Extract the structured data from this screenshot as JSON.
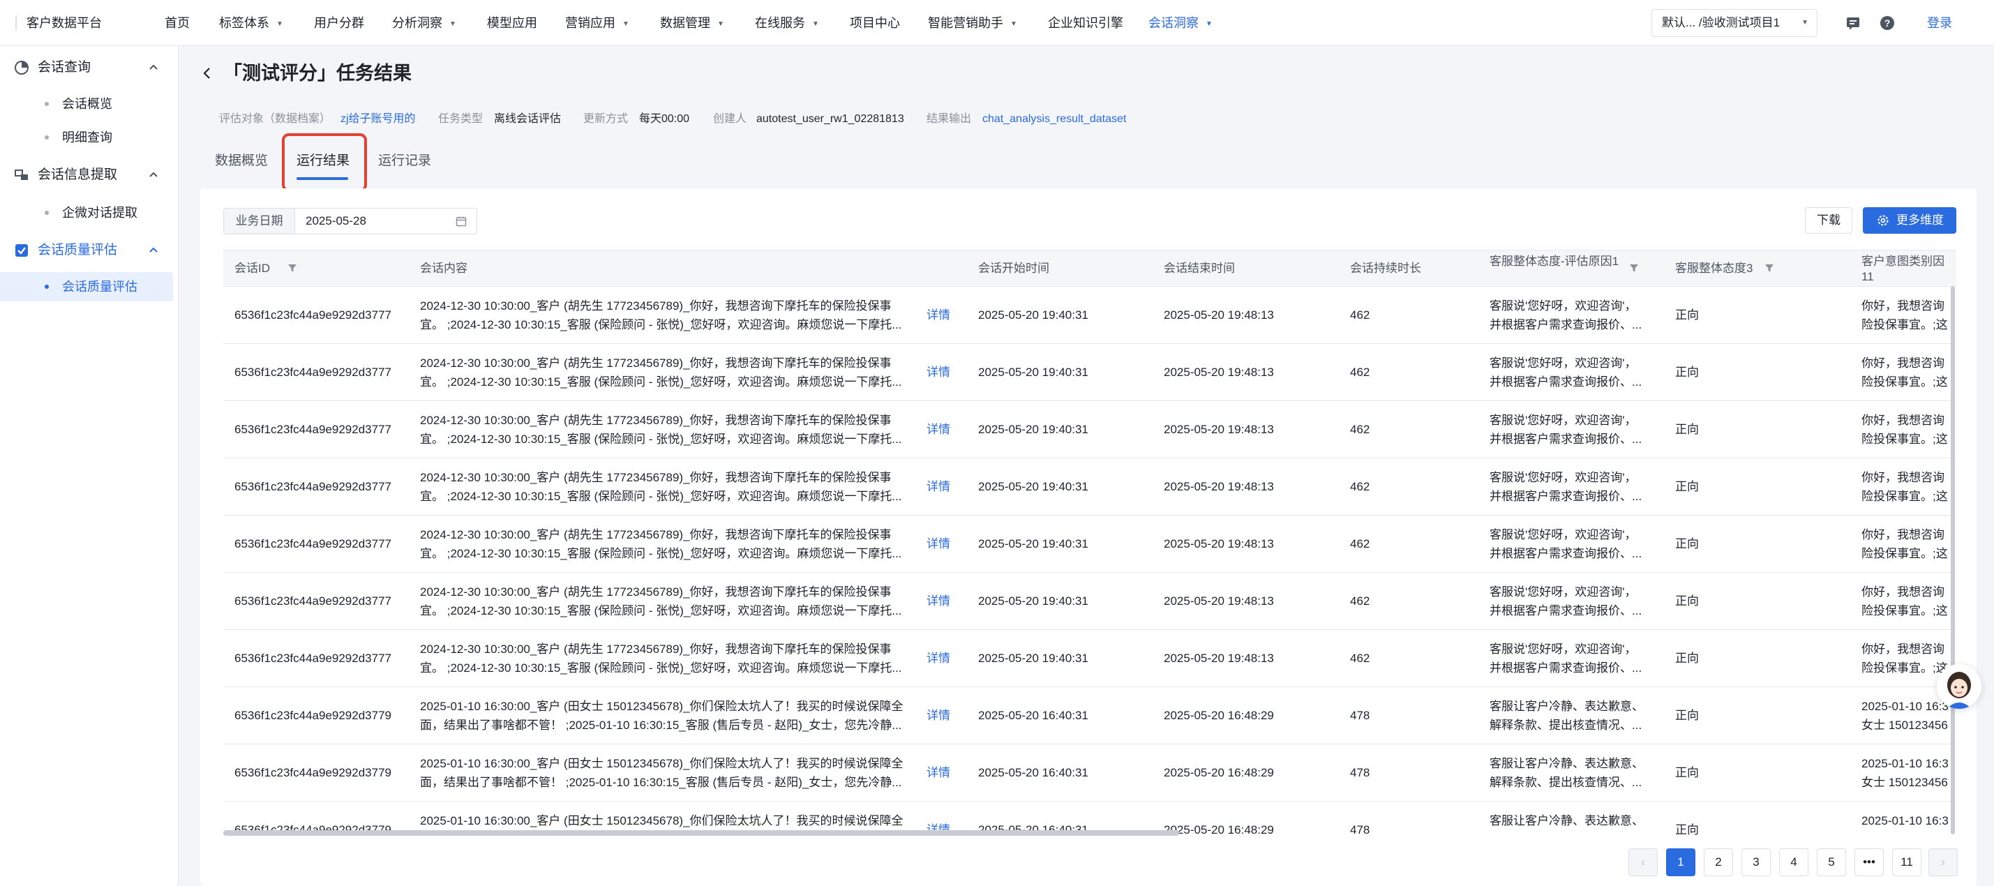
{
  "topnav": {
    "brand": "客户数据平台",
    "items": [
      {
        "label": "首页",
        "dropdown": false
      },
      {
        "label": "标签体系",
        "dropdown": true
      },
      {
        "label": "用户分群",
        "dropdown": false
      },
      {
        "label": "分析洞察",
        "dropdown": true
      },
      {
        "label": "模型应用",
        "dropdown": false
      },
      {
        "label": "营销应用",
        "dropdown": true
      },
      {
        "label": "数据管理",
        "dropdown": true
      },
      {
        "label": "在线服务",
        "dropdown": true
      },
      {
        "label": "项目中心",
        "dropdown": false
      },
      {
        "label": "智能营销助手",
        "dropdown": true
      },
      {
        "label": "企业知识引擎",
        "dropdown": false
      },
      {
        "label": "会话洞察",
        "dropdown": true,
        "active": true
      }
    ],
    "project_select": "默认...  /验收测试项目1",
    "login": "登录"
  },
  "sidebar": {
    "groups": [
      {
        "label": "会话查询",
        "icon": "chart-pie-icon",
        "items": [
          "会话概览",
          "明细查询"
        ]
      },
      {
        "label": "会话信息提取",
        "icon": "extract-icon",
        "items": [
          "企微对话提取"
        ]
      },
      {
        "label": "会话质量评估",
        "icon": "checkbox-icon",
        "active": true,
        "items": [
          "会话质量评估"
        ]
      }
    ]
  },
  "header": {
    "title": "「测试评分」任务结果",
    "meta": {
      "target_key": "评估对象（数据档案）",
      "target_val": "zj给子账号用的",
      "type_key": "任务类型",
      "type_val": "离线会话评估",
      "update_key": "更新方式",
      "update_val": "每天00:00",
      "creator_key": "创建人",
      "creator_val": "autotest_user_rw1_02281813",
      "output_key": "结果输出",
      "output_val": "chat_analysis_result_dataset"
    },
    "tabs": [
      "数据概览",
      "运行结果",
      "运行记录"
    ],
    "active_tab": "运行结果"
  },
  "toolbar": {
    "date_key": "业务日期",
    "date_val": "2025-05-28",
    "download": "下载",
    "more": "更多维度"
  },
  "table": {
    "columns": [
      "会话ID",
      "会话内容",
      "",
      "会话开始时间",
      "会话结束时间",
      "会话持续时长",
      "客服整体态度-评估原因1",
      "客服整体态度3",
      "客户意图类别因11"
    ],
    "rows": [
      {
        "id": "6536f1c23fc44a9e9292d3777",
        "content_1": "2024-12-30 10:30:00_客户 (胡先生 17723456789)_你好，我想咨询下摩托车的保险投保事",
        "content_2": "宜。 ;2024-12-30 10:30:15_客服 (保险顾问 - 张悦)_您好呀，欢迎咨询。麻烦您说一下摩托...",
        "detail": "详情",
        "start": "2025-05-20 19:40:31",
        "end": "2025-05-20 19:48:13",
        "duration": "462",
        "reason_1": "客服说'您好呀，欢迎咨询'，",
        "reason_2": "并根据客户需求查询报价、...",
        "attitude": "正向",
        "intent_1": "你好，我想咨询",
        "intent_2": "险投保事宜。;这"
      },
      {
        "id": "6536f1c23fc44a9e9292d3777",
        "content_1": "2024-12-30 10:30:00_客户 (胡先生 17723456789)_你好，我想咨询下摩托车的保险投保事",
        "content_2": "宜。 ;2024-12-30 10:30:15_客服 (保险顾问 - 张悦)_您好呀，欢迎咨询。麻烦您说一下摩托...",
        "detail": "详情",
        "start": "2025-05-20 19:40:31",
        "end": "2025-05-20 19:48:13",
        "duration": "462",
        "reason_1": "客服说'您好呀，欢迎咨询'，",
        "reason_2": "并根据客户需求查询报价、...",
        "attitude": "正向",
        "intent_1": "你好，我想咨询",
        "intent_2": "险投保事宜。;这"
      },
      {
        "id": "6536f1c23fc44a9e9292d3777",
        "content_1": "2024-12-30 10:30:00_客户 (胡先生 17723456789)_你好，我想咨询下摩托车的保险投保事",
        "content_2": "宜。 ;2024-12-30 10:30:15_客服 (保险顾问 - 张悦)_您好呀，欢迎咨询。麻烦您说一下摩托...",
        "detail": "详情",
        "start": "2025-05-20 19:40:31",
        "end": "2025-05-20 19:48:13",
        "duration": "462",
        "reason_1": "客服说'您好呀，欢迎咨询'，",
        "reason_2": "并根据客户需求查询报价、...",
        "attitude": "正向",
        "intent_1": "你好，我想咨询",
        "intent_2": "险投保事宜。;这"
      },
      {
        "id": "6536f1c23fc44a9e9292d3777",
        "content_1": "2024-12-30 10:30:00_客户 (胡先生 17723456789)_你好，我想咨询下摩托车的保险投保事",
        "content_2": "宜。 ;2024-12-30 10:30:15_客服 (保险顾问 - 张悦)_您好呀，欢迎咨询。麻烦您说一下摩托...",
        "detail": "详情",
        "start": "2025-05-20 19:40:31",
        "end": "2025-05-20 19:48:13",
        "duration": "462",
        "reason_1": "客服说'您好呀，欢迎咨询'，",
        "reason_2": "并根据客户需求查询报价、...",
        "attitude": "正向",
        "intent_1": "你好，我想咨询",
        "intent_2": "险投保事宜。;这"
      },
      {
        "id": "6536f1c23fc44a9e9292d3777",
        "content_1": "2024-12-30 10:30:00_客户 (胡先生 17723456789)_你好，我想咨询下摩托车的保险投保事",
        "content_2": "宜。 ;2024-12-30 10:30:15_客服 (保险顾问 - 张悦)_您好呀，欢迎咨询。麻烦您说一下摩托...",
        "detail": "详情",
        "start": "2025-05-20 19:40:31",
        "end": "2025-05-20 19:48:13",
        "duration": "462",
        "reason_1": "客服说'您好呀，欢迎咨询'，",
        "reason_2": "并根据客户需求查询报价、...",
        "attitude": "正向",
        "intent_1": "你好，我想咨询",
        "intent_2": "险投保事宜。;这"
      },
      {
        "id": "6536f1c23fc44a9e9292d3777",
        "content_1": "2024-12-30 10:30:00_客户 (胡先生 17723456789)_你好，我想咨询下摩托车的保险投保事",
        "content_2": "宜。 ;2024-12-30 10:30:15_客服 (保险顾问 - 张悦)_您好呀，欢迎咨询。麻烦您说一下摩托...",
        "detail": "详情",
        "start": "2025-05-20 19:40:31",
        "end": "2025-05-20 19:48:13",
        "duration": "462",
        "reason_1": "客服说'您好呀，欢迎咨询'，",
        "reason_2": "并根据客户需求查询报价、...",
        "attitude": "正向",
        "intent_1": "你好，我想咨询",
        "intent_2": "险投保事宜。;这"
      },
      {
        "id": "6536f1c23fc44a9e9292d3777",
        "content_1": "2024-12-30 10:30:00_客户 (胡先生 17723456789)_你好，我想咨询下摩托车的保险投保事",
        "content_2": "宜。 ;2024-12-30 10:30:15_客服 (保险顾问 - 张悦)_您好呀，欢迎咨询。麻烦您说一下摩托...",
        "detail": "详情",
        "start": "2025-05-20 19:40:31",
        "end": "2025-05-20 19:48:13",
        "duration": "462",
        "reason_1": "客服说'您好呀，欢迎咨询'，",
        "reason_2": "并根据客户需求查询报价、...",
        "attitude": "正向",
        "intent_1": "你好，我想咨询",
        "intent_2": "险投保事宜。;这"
      },
      {
        "id": "6536f1c23fc44a9e9292d3779",
        "content_1": "2025-01-10 16:30:00_客户 (田女士 15012345678)_你们保险太坑人了！我买的时候说保障全",
        "content_2": "面，结果出了事啥都不管！ ;2025-01-10 16:30:15_客服 (售后专员 - 赵阳)_女士，您先冷静...",
        "detail": "详情",
        "start": "2025-05-20 16:40:31",
        "end": "2025-05-20 16:48:29",
        "duration": "478",
        "reason_1": "客服让客户冷静、表达歉意、",
        "reason_2": "解释条款、提出核查情况、...",
        "attitude": "正向",
        "intent_1": "2025-01-10 16:3",
        "intent_2": "女士 150123456"
      },
      {
        "id": "6536f1c23fc44a9e9292d3779",
        "content_1": "2025-01-10 16:30:00_客户 (田女士 15012345678)_你们保险太坑人了！我买的时候说保障全",
        "content_2": "面，结果出了事啥都不管！ ;2025-01-10 16:30:15_客服 (售后专员 - 赵阳)_女士，您先冷静...",
        "detail": "详情",
        "start": "2025-05-20 16:40:31",
        "end": "2025-05-20 16:48:29",
        "duration": "478",
        "reason_1": "客服让客户冷静、表达歉意、",
        "reason_2": "解释条款、提出核查情况、...",
        "attitude": "正向",
        "intent_1": "2025-01-10 16:3",
        "intent_2": "女士 150123456"
      },
      {
        "id": "6536f1c23fc44a9e9292d3779",
        "content_1": "2025-01-10 16:30:00_客户 (田女士 15012345678)_你们保险太坑人了！我买的时候说保障全",
        "content_2": "",
        "detail": "详情",
        "start": "2025-05-20 16:40:31",
        "end": "2025-05-20 16:48:29",
        "duration": "478",
        "reason_1": "客服让客户冷静、表达歉意、",
        "reason_2": "",
        "attitude": "正向",
        "intent_1": "2025-01-10 16:3",
        "intent_2": ""
      }
    ]
  },
  "pagination": {
    "pages": [
      "1",
      "2",
      "3",
      "4",
      "5",
      "•••",
      "11"
    ],
    "current": "1",
    "prev": "‹",
    "next": "›"
  },
  "colors": {
    "accent": "#2b6be0",
    "highlight": "#e0432f"
  }
}
